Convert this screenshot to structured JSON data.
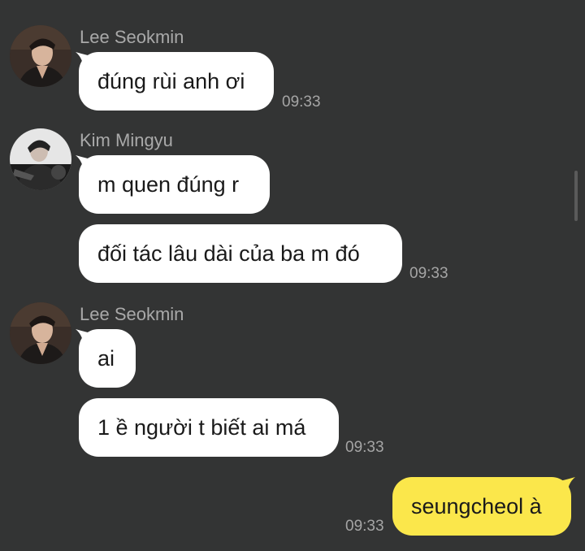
{
  "chat": {
    "groups": [
      {
        "sender": "Lee Seokmin",
        "avatar": "lee-seokmin-avatar",
        "messages": [
          {
            "text": "đúng rùi anh ơi",
            "time": "09:33"
          }
        ]
      },
      {
        "sender": "Kim Mingyu",
        "avatar": "kim-mingyu-avatar",
        "messages": [
          {
            "text": "m quen đúng r"
          },
          {
            "text": "đối tác lâu dài của ba m đó",
            "time": "09:33"
          }
        ]
      },
      {
        "sender": "Lee Seokmin",
        "avatar": "lee-seokmin-avatar",
        "messages": [
          {
            "text": "ai"
          },
          {
            "text": "1 ề người t biết ai má",
            "time": "09:33"
          }
        ]
      }
    ],
    "outgoing": [
      {
        "text": "seungcheol à",
        "time": "09:33"
      }
    ]
  },
  "theme": {
    "background": "#333434",
    "incoming_bubble": "#ffffff",
    "outgoing_bubble": "#fbe74b",
    "name_color": "#a9a9a9",
    "time_color": "#a5a5a5"
  }
}
